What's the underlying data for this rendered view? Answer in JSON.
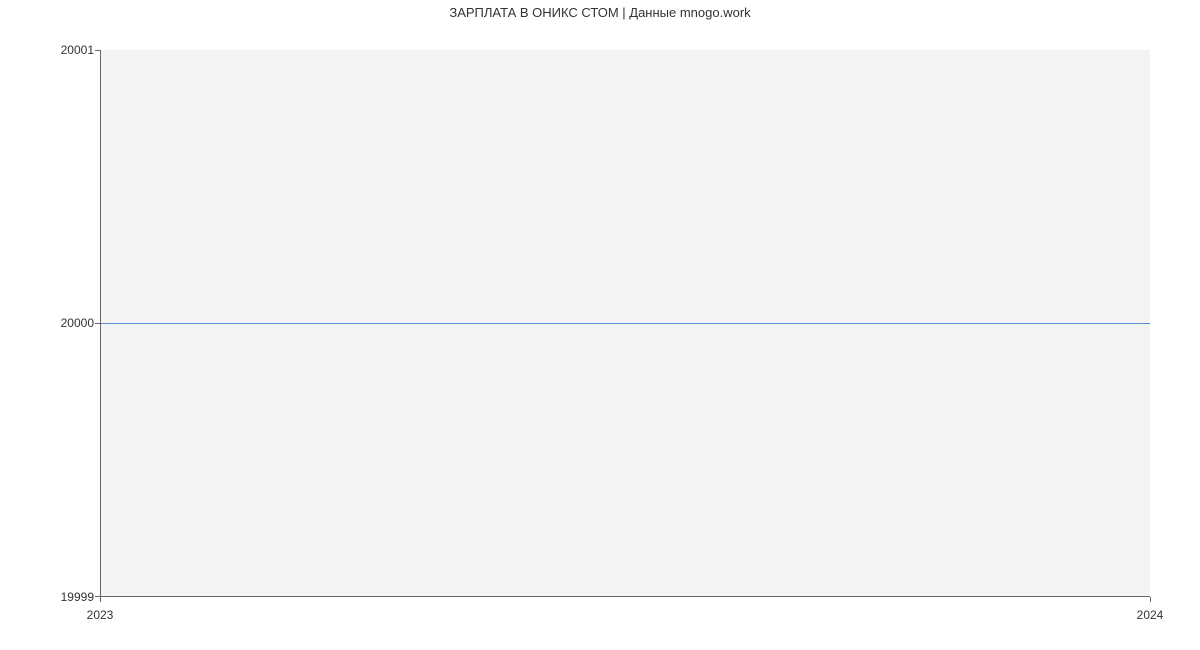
{
  "chart_data": {
    "type": "line",
    "title": "ЗАРПЛАТА В  ОНИКС СТОМ | Данные mnogo.work",
    "x": [
      2023,
      2024
    ],
    "y": [
      20000,
      20000
    ],
    "xlabel": "",
    "ylabel": "",
    "xlim": [
      2023,
      2024
    ],
    "ylim": [
      19999,
      20001
    ],
    "x_ticks": [
      2023,
      2024
    ],
    "y_ticks": [
      19999,
      20000,
      20001
    ],
    "line_color": "#5b8fd6",
    "plot_bgcolor": "#f4f4f4"
  }
}
